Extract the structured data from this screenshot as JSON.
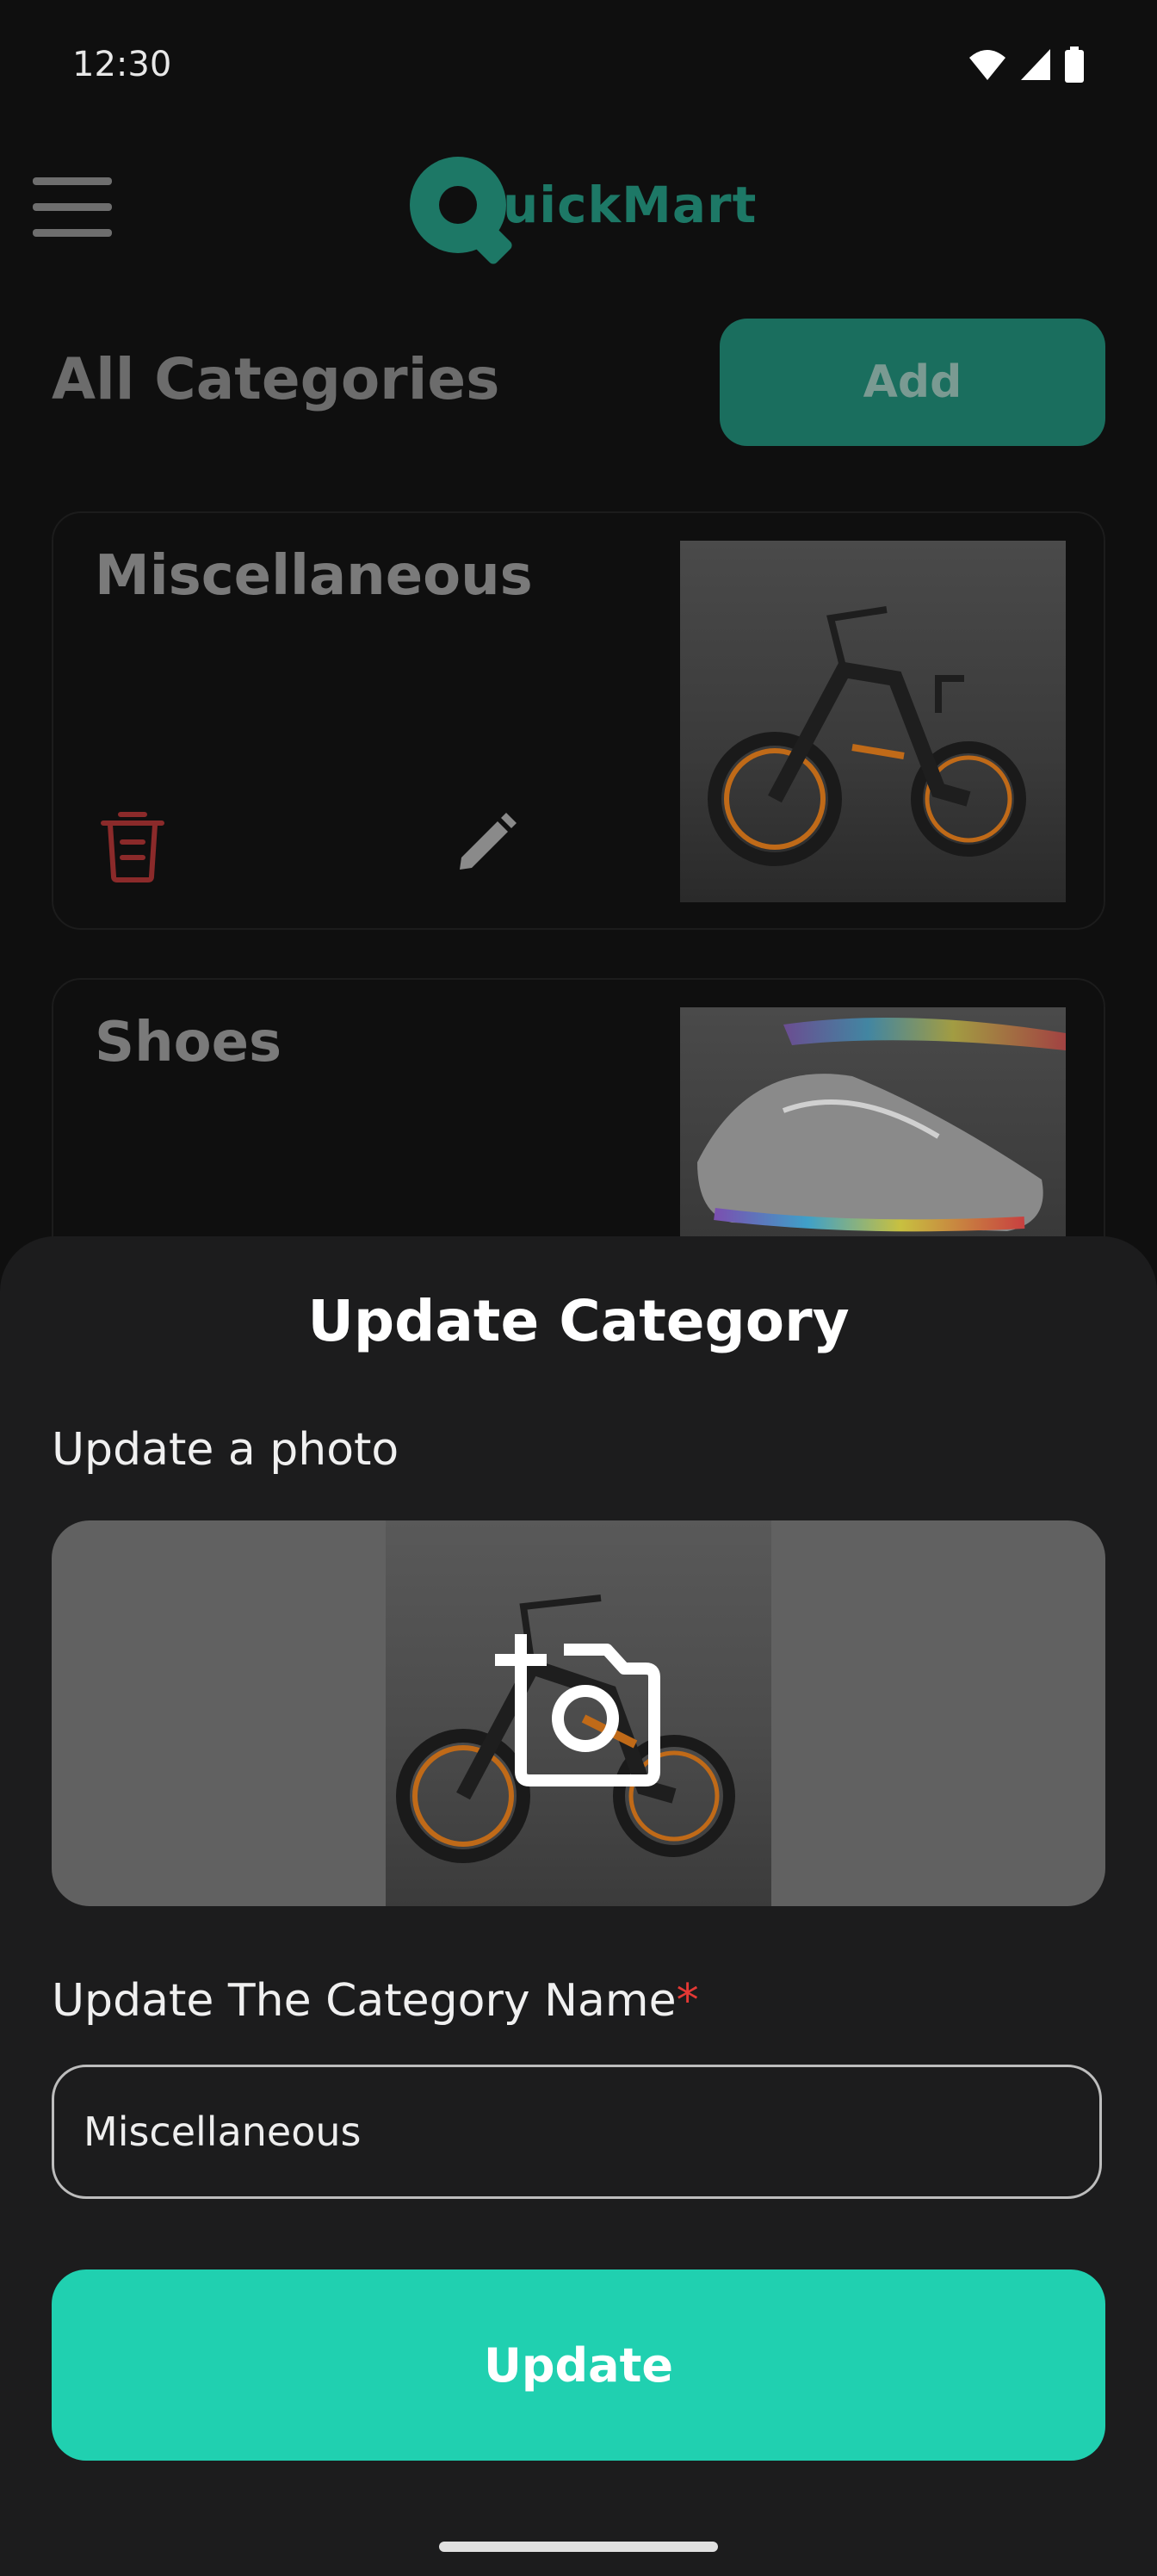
{
  "status_bar": {
    "time": "12:30",
    "icons": [
      "wifi-icon",
      "signal-icon",
      "battery-icon"
    ]
  },
  "header": {
    "logo_letter": "Q",
    "logo_text": "uickMart",
    "menu_icon": "hamburger-menu-icon"
  },
  "page": {
    "title": "All Categories",
    "add_label": "Add"
  },
  "categories": [
    {
      "name": "Miscellaneous",
      "photo": "electric bicycle photo"
    },
    {
      "name": "Shoes",
      "photo": "sneakers photo"
    }
  ],
  "sheet": {
    "title": "Update Category",
    "photo_label": "Update a photo",
    "name_label": "Update The Category Name",
    "required_mark": "*",
    "name_value": "Miscellaneous",
    "update_label": "Update"
  },
  "colors": {
    "accent": "#20d0b0",
    "logo": "#1d7866",
    "delete": "#8b2a2a",
    "required": "#e53935"
  }
}
